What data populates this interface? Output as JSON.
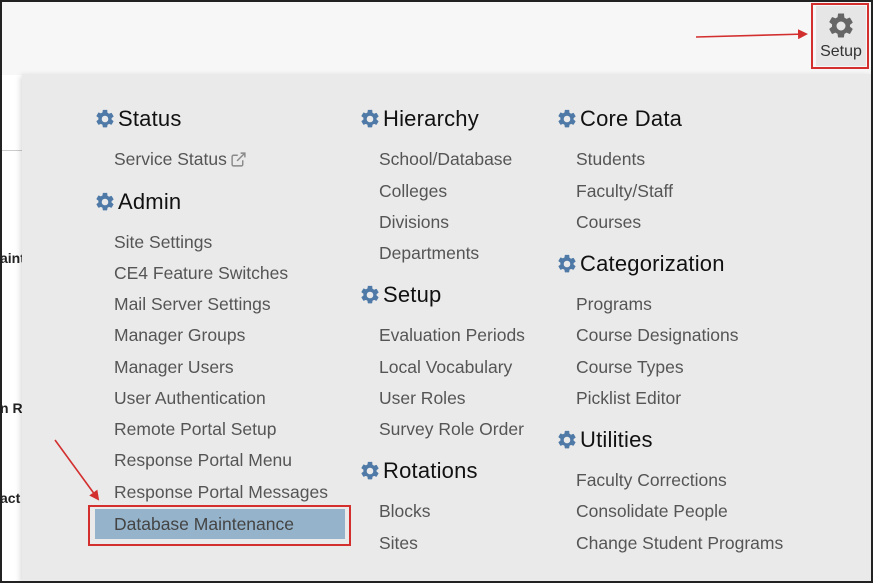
{
  "header": {
    "setup_label": "Setup",
    "gear_color": "#666666"
  },
  "underlay": {
    "fragments": [
      "aint",
      "n R",
      "act"
    ]
  },
  "colors": {
    "heading_gear": "#4f79a6",
    "selected_bg": "#95b4cb",
    "annotation_red": "#d32f2f"
  },
  "menu": {
    "status": {
      "title": "Status",
      "items": [
        "Service Status"
      ]
    },
    "admin": {
      "title": "Admin",
      "items": [
        "Site Settings",
        "CE4 Feature Switches",
        "Mail Server Settings",
        "Manager Groups",
        "Manager Users",
        "User Authentication",
        "Remote Portal Setup",
        "Response Portal Menu",
        "Response Portal Messages",
        "Database Maintenance"
      ],
      "selected": "Database Maintenance"
    },
    "hierarchy": {
      "title": "Hierarchy",
      "items": [
        "School/Database",
        "Colleges",
        "Divisions",
        "Departments"
      ]
    },
    "setup": {
      "title": "Setup",
      "items": [
        "Evaluation Periods",
        "Local Vocabulary",
        "User Roles",
        "Survey Role Order"
      ]
    },
    "rotations": {
      "title": "Rotations",
      "items": [
        "Blocks",
        "Sites"
      ]
    },
    "core_data": {
      "title": "Core Data",
      "items": [
        "Students",
        "Faculty/Staff",
        "Courses"
      ]
    },
    "categorization": {
      "title": "Categorization",
      "items": [
        "Programs",
        "Course Designations",
        "Course Types",
        "Picklist Editor"
      ]
    },
    "utilities": {
      "title": "Utilities",
      "items": [
        "Faculty Corrections",
        "Consolidate People",
        "Change Student Programs"
      ]
    }
  }
}
